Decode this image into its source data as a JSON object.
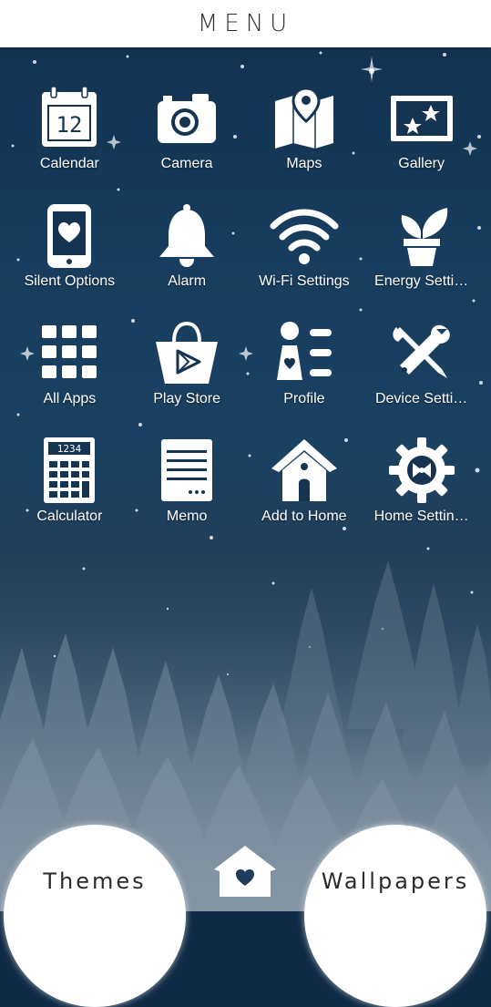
{
  "header": {
    "title": "MENU"
  },
  "apps": [
    {
      "label": "Calendar",
      "icon": "calendar-icon"
    },
    {
      "label": "Camera",
      "icon": "camera-icon"
    },
    {
      "label": "Maps",
      "icon": "map-icon"
    },
    {
      "label": "Gallery",
      "icon": "gallery-icon"
    },
    {
      "label": "Silent Options",
      "icon": "phone-heart-icon"
    },
    {
      "label": "Alarm",
      "icon": "bell-icon"
    },
    {
      "label": "Wi-Fi Settings",
      "icon": "wifi-icon"
    },
    {
      "label": "Energy Setti…",
      "icon": "plant-icon"
    },
    {
      "label": "All Apps",
      "icon": "grid-icon"
    },
    {
      "label": "Play Store",
      "icon": "shopping-bag-icon"
    },
    {
      "label": "Profile",
      "icon": "profile-icon"
    },
    {
      "label": "Device Setti…",
      "icon": "tools-icon"
    },
    {
      "label": "Calculator",
      "icon": "calculator-icon"
    },
    {
      "label": "Memo",
      "icon": "memo-icon"
    },
    {
      "label": "Add to Home",
      "icon": "house-icon"
    },
    {
      "label": "Home Settin…",
      "icon": "gear-icon"
    }
  ],
  "calendar_day": "12",
  "calculator_display": "1234",
  "bottom": {
    "themes_label": "Themes",
    "wallpapers_label": "Wallpapers",
    "home_icon": "house-heart-icon"
  },
  "colors": {
    "sky_top": "#123250",
    "sky_bottom": "#b8c2ca",
    "icon": "#ffffff"
  }
}
